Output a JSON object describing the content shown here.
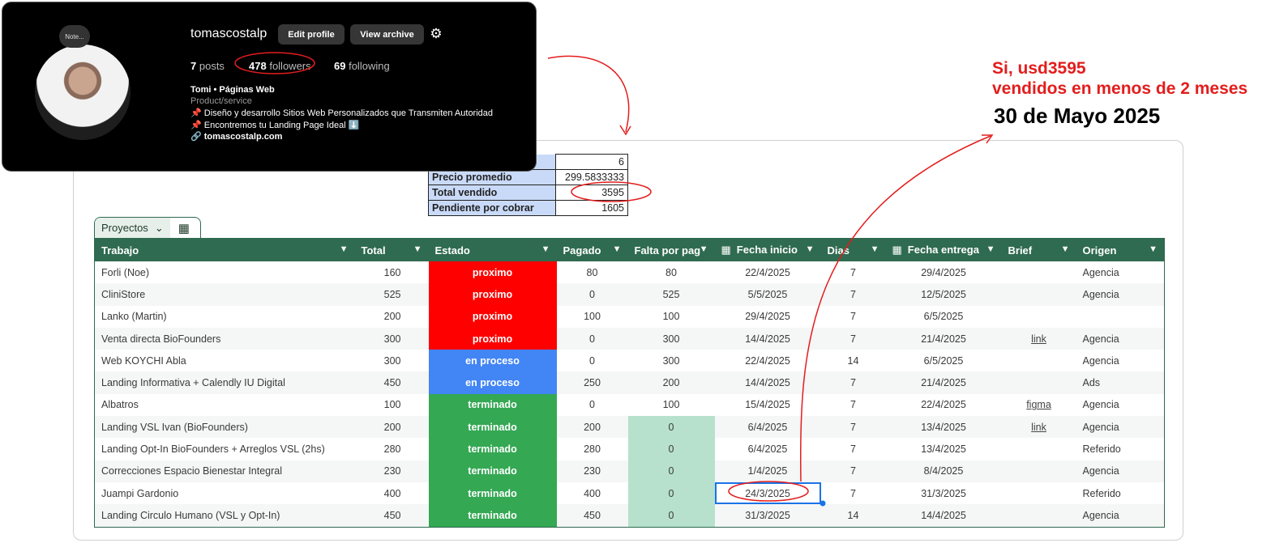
{
  "instagram": {
    "note": "Note...",
    "username": "tomascostalp",
    "edit_profile": "Edit profile",
    "view_archive": "View archive",
    "posts_count": "7",
    "posts_label": "posts",
    "followers_count": "478",
    "followers_label": "followers",
    "following_count": "69",
    "following_label": "following",
    "name": "Tomi • Páginas Web",
    "category": "Product/service",
    "bio_line1": "📌 Diseño y desarrollo Sitios Web Personalizados que Transmiten Autoridad",
    "bio_line2": "📌 Encontremos tu Landing Page Ideal ⬇️",
    "link": "tomascostalp.com"
  },
  "annotation": {
    "line1": "Si, usd3595",
    "line2": "vendidos en menos de 2 meses",
    "date": "30 de Mayo 2025"
  },
  "summary": {
    "rows": [
      {
        "label": "",
        "value": "6"
      },
      {
        "label": "Precio promedio",
        "value": "299.5833333"
      },
      {
        "label": "Total vendido",
        "value": "3595"
      },
      {
        "label": "Pendiente por cobrar",
        "value": "1605"
      }
    ]
  },
  "sheet": {
    "tab_name": "Proyectos",
    "columns": [
      "Trabajo",
      "Total",
      "Estado",
      "Pagado",
      "Falta por pag",
      "Fecha inicio",
      "Dias",
      "Fecha entrega",
      "Brief",
      "Origen"
    ],
    "status_colors": {
      "proximo": "#ff0000",
      "en proceso": "#4285f4",
      "terminado": "#34a853"
    },
    "rows": [
      {
        "trabajo": "Forli (Noe)",
        "total": "160",
        "estado": "proximo",
        "pagado": "80",
        "falta": "80",
        "inicio": "22/4/2025",
        "dias": "7",
        "entrega": "29/4/2025",
        "brief": "",
        "origen": "Agencia"
      },
      {
        "trabajo": "CliniStore",
        "total": "525",
        "estado": "proximo",
        "pagado": "0",
        "falta": "525",
        "inicio": "5/5/2025",
        "dias": "7",
        "entrega": "12/5/2025",
        "brief": "",
        "origen": "Agencia"
      },
      {
        "trabajo": "Lanko (Martin)",
        "total": "200",
        "estado": "proximo",
        "pagado": "100",
        "falta": "100",
        "inicio": "29/4/2025",
        "dias": "7",
        "entrega": "6/5/2025",
        "brief": "",
        "origen": ""
      },
      {
        "trabajo": "Venta directa BioFounders",
        "total": "300",
        "estado": "proximo",
        "pagado": "0",
        "falta": "300",
        "inicio": "14/4/2025",
        "dias": "7",
        "entrega": "21/4/2025",
        "brief": "link",
        "origen": "Agencia"
      },
      {
        "trabajo": "Web KOYCHI Abla",
        "total": "300",
        "estado": "en proceso",
        "pagado": "0",
        "falta": "300",
        "inicio": "22/4/2025",
        "dias": "14",
        "entrega": "6/5/2025",
        "brief": "",
        "origen": "Agencia"
      },
      {
        "trabajo": "Landing Informativa + Calendly IU Digital",
        "total": "450",
        "estado": "en proceso",
        "pagado": "250",
        "falta": "200",
        "inicio": "14/4/2025",
        "dias": "7",
        "entrega": "21/4/2025",
        "brief": "",
        "origen": "Ads"
      },
      {
        "trabajo": "Albatros",
        "total": "100",
        "estado": "terminado",
        "pagado": "0",
        "falta": "100",
        "inicio": "15/4/2025",
        "dias": "7",
        "entrega": "22/4/2025",
        "brief": "figma",
        "origen": "Agencia"
      },
      {
        "trabajo": "Landing VSL Ivan (BioFounders)",
        "total": "200",
        "estado": "terminado",
        "pagado": "200",
        "falta": "0",
        "inicio": "6/4/2025",
        "dias": "7",
        "entrega": "13/4/2025",
        "brief": "link",
        "origen": "Agencia"
      },
      {
        "trabajo": "Landing Opt-In BioFounders + Arreglos VSL (2hs)",
        "total": "280",
        "estado": "terminado",
        "pagado": "280",
        "falta": "0",
        "inicio": "6/4/2025",
        "dias": "7",
        "entrega": "13/4/2025",
        "brief": "",
        "origen": "Referido"
      },
      {
        "trabajo": "Correcciones Espacio Bienestar Integral",
        "total": "230",
        "estado": "terminado",
        "pagado": "230",
        "falta": "0",
        "inicio": "1/4/2025",
        "dias": "7",
        "entrega": "8/4/2025",
        "brief": "",
        "origen": "Agencia"
      },
      {
        "trabajo": "Juampi Gardonio",
        "total": "400",
        "estado": "terminado",
        "pagado": "400",
        "falta": "0",
        "inicio": "24/3/2025",
        "dias": "7",
        "entrega": "31/3/2025",
        "brief": "",
        "origen": "Referido"
      },
      {
        "trabajo": "Landing Circulo Humano (VSL y Opt-In)",
        "total": "450",
        "estado": "terminado",
        "pagado": "450",
        "falta": "0",
        "inicio": "31/3/2025",
        "dias": "14",
        "entrega": "14/4/2025",
        "brief": "",
        "origen": "Agencia"
      }
    ]
  }
}
